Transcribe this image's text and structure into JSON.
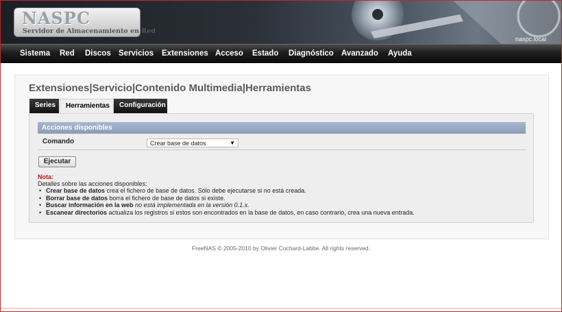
{
  "header": {
    "logo_title": "NASPC",
    "logo_subtitle": "Servidor de Almacenamiento en Red",
    "hostname": "naspc.local"
  },
  "nav": {
    "items": [
      "Sistema",
      "Red",
      "Discos",
      "Servicios",
      "Extensiones",
      "Acceso",
      "Estado",
      "Diagnóstico",
      "Avanzado",
      "Ayuda"
    ]
  },
  "breadcrumb": {
    "items": [
      "Extensiones",
      "Servicio",
      "Contenido Multimedia",
      "Herramientas"
    ],
    "separator": "|"
  },
  "tabs": {
    "items": [
      "Series",
      "Herramientas",
      "Configuración"
    ],
    "active": "Herramientas"
  },
  "section": {
    "title": "Acciones disponibles",
    "command_label": "Comando",
    "command_selected": "Crear base de datos",
    "execute_label": "Ejecutar"
  },
  "note": {
    "title": "Nota:",
    "intro": "Detalles sobre las acciones disponibles:",
    "items": [
      {
        "bold": "Crear base de datos",
        "text": " crea el fichero de base de datos. Sólo debe ejecutarse si no está creada."
      },
      {
        "bold": "Borrar base de datos",
        "text": " borra el fichero de base de datos si existe."
      },
      {
        "bold": "Buscar información en la web",
        "text": " no está implementada en la versión 0.1.x."
      },
      {
        "bold": "Escanear directorios",
        "text": " actualiza los registros si estos son encontrados en la base de datos, en caso contrario, crea una nueva entrada."
      }
    ]
  },
  "footer": {
    "text": "FreeNAS © 2005-2010 by Olivier Cochard-Labbe. All rights reserved."
  },
  "colors": {
    "nav_bg": "#111111",
    "section_header": "#8a9db8",
    "note_title": "#b0151b"
  }
}
